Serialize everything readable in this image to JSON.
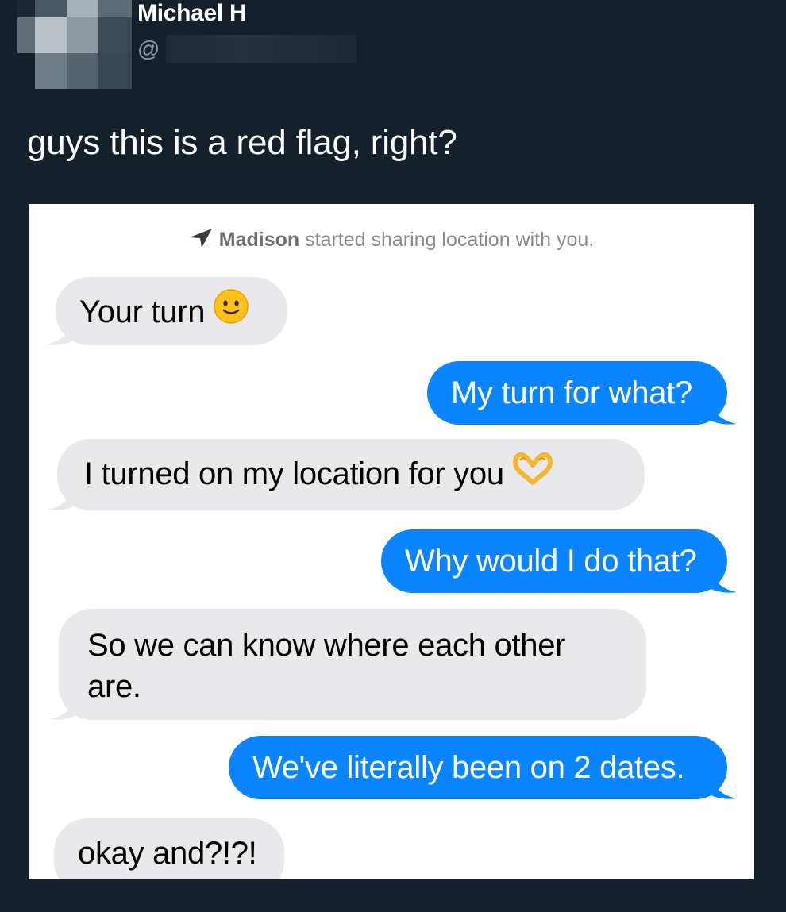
{
  "tweet": {
    "author_name": "Michael H",
    "handle_prefix": "@",
    "text": "guys this is a red flag, right?"
  },
  "conversation": {
    "system_note": {
      "sender": "Madison",
      "text": " started sharing location with you.",
      "icon": "location-arrow-icon"
    },
    "messages": [
      {
        "from": "them",
        "text": "Your turn",
        "emoji": "slightly-smiling-face-icon"
      },
      {
        "from": "me",
        "text": "My turn for what?"
      },
      {
        "from": "them",
        "text": "I turned on my location for you",
        "emoji": "heart-hands-icon"
      },
      {
        "from": "me",
        "text": "Why would I do that?"
      },
      {
        "from": "them",
        "line1": "So we can know where each other",
        "line2": "are."
      },
      {
        "from": "me",
        "text": "We've literally been on 2 dates."
      },
      {
        "from": "them",
        "text": "okay and?!?!"
      }
    ]
  },
  "colors": {
    "background": "#15202b",
    "incoming_bubble": "#e9e9eb",
    "outgoing_bubble": "#0a84ff"
  }
}
